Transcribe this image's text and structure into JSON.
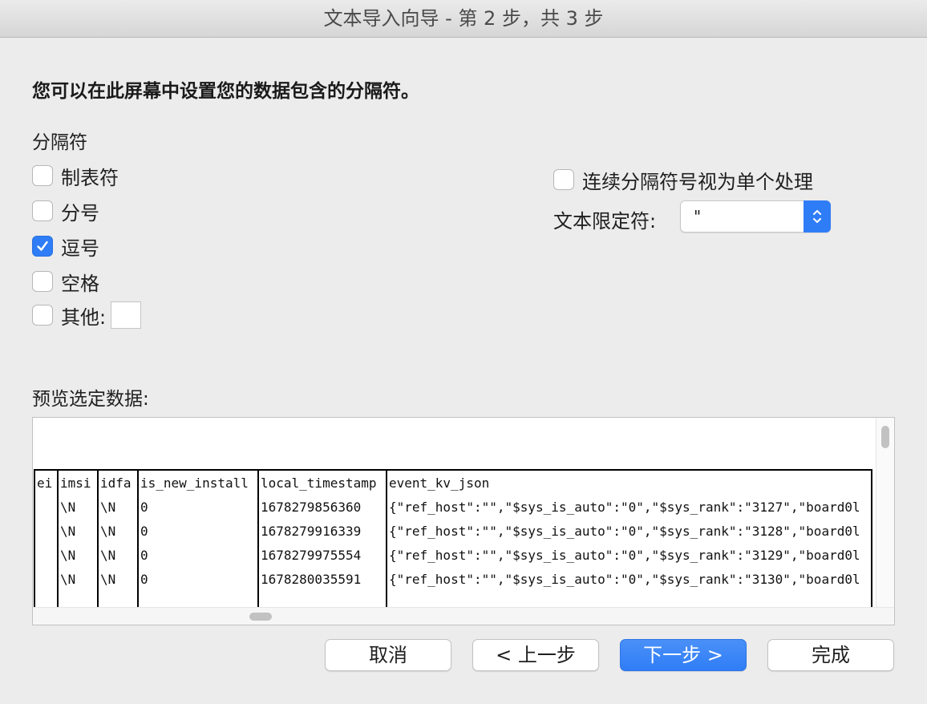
{
  "window": {
    "title": "文本导入向导 - 第 2 步，共 3 步"
  },
  "intro": "您可以在此屏幕中设置您的数据包含的分隔符。",
  "delimiters": {
    "label": "分隔符",
    "tab": {
      "label": "制表符",
      "checked": false
    },
    "semicolon": {
      "label": "分号",
      "checked": false
    },
    "comma": {
      "label": "逗号",
      "checked": true
    },
    "space": {
      "label": "空格",
      "checked": false
    },
    "other": {
      "label": "其他:",
      "checked": false,
      "value": ""
    }
  },
  "consecutive": {
    "label": "连续分隔符号视为单个处理",
    "checked": false
  },
  "qualifier": {
    "label": "文本限定符:",
    "value": "\""
  },
  "preview": {
    "label": "预览选定数据:",
    "columns": [
      "ei",
      "imsi",
      "idfa",
      "is_new_install",
      "local_timestamp",
      "event_kv_json"
    ],
    "rows": [
      [
        "",
        "\\N",
        "\\N",
        "0",
        "1678279856360",
        "{\"ref_host\":\"\",\"$sys_is_auto\":\"0\",\"$sys_rank\":\"3127\",\"board0l"
      ],
      [
        "",
        "\\N",
        "\\N",
        "0",
        "1678279916339",
        "{\"ref_host\":\"\",\"$sys_is_auto\":\"0\",\"$sys_rank\":\"3128\",\"board0l"
      ],
      [
        "",
        "\\N",
        "\\N",
        "0",
        "1678279975554",
        "{\"ref_host\":\"\",\"$sys_is_auto\":\"0\",\"$sys_rank\":\"3129\",\"board0l"
      ],
      [
        "",
        "\\N",
        "\\N",
        "0",
        "1678280035591",
        "{\"ref_host\":\"\",\"$sys_is_auto\":\"0\",\"$sys_rank\":\"3130\",\"board0l"
      ]
    ]
  },
  "buttons": {
    "cancel": "取消",
    "back": "< 上一步",
    "next": "下一步 >",
    "finish": "完成"
  },
  "colors": {
    "accent": "#2f7df6",
    "window_bg": "#ececec"
  }
}
